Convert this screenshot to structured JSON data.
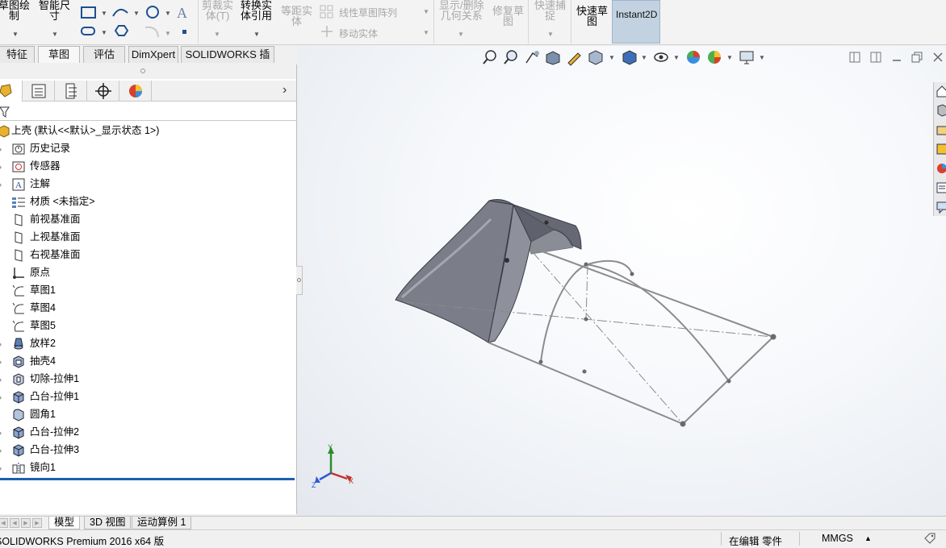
{
  "ribbon": {
    "sketch_draw": "草图绘\n制",
    "smart_dim": "智能尺\n寸",
    "trim": "剪裁实\n体(T)",
    "convert": "转换实\n体引用",
    "offset": "等距实\n体",
    "linear_pattern": "线性草图阵列",
    "move_entities": "移动实体",
    "display_relations": "显示/删除\n几何关系",
    "repair_sketch": "修复草\n图",
    "quick_snap": "快速捕\n捉",
    "rapid_sketch": "快速草\n图",
    "instant2d": "Instant2D"
  },
  "command_tabs": [
    {
      "label": "特征",
      "active": false
    },
    {
      "label": "草图",
      "active": true
    },
    {
      "label": "评估",
      "active": false
    },
    {
      "label": "DimXpert",
      "active": false
    },
    {
      "label": "SOLIDWORKS 插件",
      "active": false
    }
  ],
  "tree": {
    "root": "上壳 (默认<<默认>_显示状态 1>)",
    "items": [
      {
        "label": "历史记录",
        "icon": "history-icon"
      },
      {
        "label": "传感器",
        "icon": "sensor-icon"
      },
      {
        "label": "注解",
        "icon": "annotation-icon"
      },
      {
        "label": "材质 <未指定>",
        "icon": "material-icon"
      },
      {
        "label": "前视基准面",
        "icon": "plane-icon"
      },
      {
        "label": "上视基准面",
        "icon": "plane-icon"
      },
      {
        "label": "右视基准面",
        "icon": "plane-icon"
      },
      {
        "label": "原点",
        "icon": "origin-icon"
      },
      {
        "label": "草图1",
        "icon": "sketch-icon"
      },
      {
        "label": "草图4",
        "icon": "sketch-icon"
      },
      {
        "label": "草图5",
        "icon": "sketch-icon"
      },
      {
        "label": "放样2",
        "icon": "loft-icon"
      },
      {
        "label": "抽壳4",
        "icon": "shell-icon"
      },
      {
        "label": "切除-拉伸1",
        "icon": "cut-extrude-icon"
      },
      {
        "label": "凸台-拉伸1",
        "icon": "boss-extrude-icon"
      },
      {
        "label": "圆角1",
        "icon": "fillet-icon"
      },
      {
        "label": "凸台-拉伸2",
        "icon": "boss-extrude-icon"
      },
      {
        "label": "凸台-拉伸3",
        "icon": "boss-extrude-icon"
      },
      {
        "label": "镜向1",
        "icon": "mirror-icon"
      }
    ]
  },
  "bottom_tabs": [
    {
      "label": "模型",
      "active": true
    },
    {
      "label": "3D 视图",
      "active": false
    },
    {
      "label": "运动算例 1",
      "active": false
    }
  ],
  "status": {
    "app": "SOLIDWORKS Premium 2016 x64 版",
    "mode": "在编辑 零件",
    "units": "MMGS"
  },
  "triad": {
    "x": "X",
    "y": "Y",
    "z": "Z"
  },
  "colors": {
    "accent": "#1c5fb0",
    "part_surface": "#6d6f7a",
    "sketch_line": "#8c8c8c"
  }
}
